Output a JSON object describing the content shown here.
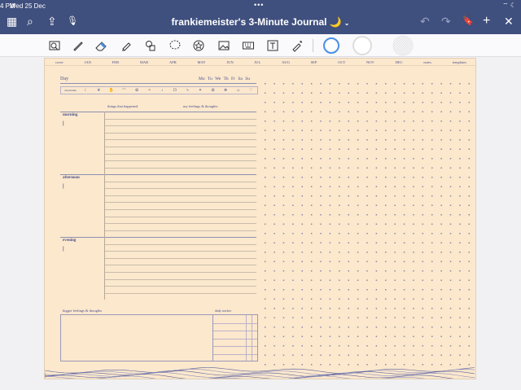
{
  "status": {
    "time": "4 PM",
    "date": "Wed 25 Dec",
    "dots": "•••",
    "icons": "⌔ ☾"
  },
  "app": {
    "title": "frankiemeister's 3-Minute Journal 🌙"
  },
  "topbar": {
    "grid_icon": "▦",
    "search_icon": "⌕",
    "share_icon": "⇪",
    "mic_icon": "🎙",
    "undo_icon": "↶",
    "redo_icon": "↷",
    "bookmark_icon": "🔖",
    "add_page_icon": "+",
    "close_icon": "✕"
  },
  "toolbar": {
    "accent": "#4a90e2"
  },
  "tabs": [
    "cover",
    "JAN",
    "FEB",
    "MAR",
    "APR",
    "MAY",
    "JUN",
    "JUL",
    "AUG",
    "SEP",
    "OCT",
    "NOV",
    "DEC",
    "notes",
    "templates"
  ],
  "journal": {
    "day_label": "Day",
    "weekdays": "Mo Tu We Th Fr Sa Su",
    "mood_label": "dreamtime",
    "mood_icons": [
      "☾",
      "❦",
      "✋",
      "⌒",
      "✿",
      "✧",
      "♪",
      "☊",
      "∿",
      "✦",
      "✿",
      "❀",
      "☺",
      "♡"
    ],
    "col_happened": "things that happened",
    "col_feelings": "my feelings & thoughts",
    "sections": [
      {
        "name": "morning",
        "marks": "|||"
      },
      {
        "name": "afternoon",
        "marks": "|||"
      },
      {
        "name": "evening",
        "marks": "|||"
      }
    ],
    "bigger_label": "bigger feelings & thoughts",
    "tracker_label": "daily tracker"
  }
}
